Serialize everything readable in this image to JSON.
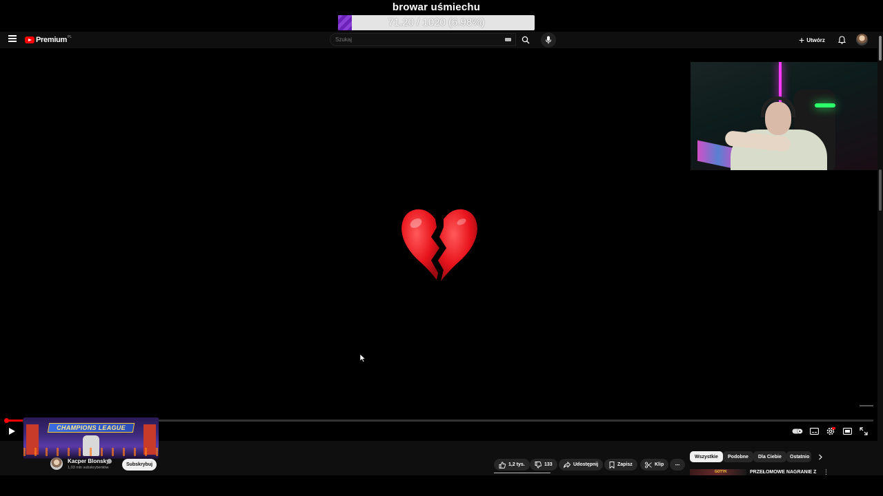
{
  "overlay": {
    "goal_title": "browar uśmiechu",
    "goal_text": "71.20 / 1020 (6.98%)",
    "goal_fraction": 0.0698,
    "goal_color": "#7a32c8"
  },
  "masthead": {
    "logo_text": "Premium",
    "logo_region": "PL",
    "search_placeholder": "Szukaj",
    "create_label": "Utwórz",
    "icons": [
      "menu-icon",
      "youtube-logo-icon",
      "keyboard-icon",
      "search-icon",
      "mic-icon",
      "plus-icon",
      "bell-icon",
      "avatar"
    ]
  },
  "player": {
    "center_emoji": "broken-heart",
    "progress_fraction": 0.02,
    "accent_color": "#ff0000",
    "controls": [
      "play-icon",
      "autoplay-toggle",
      "subtitles-icon",
      "settings-icon",
      "theater-icon",
      "fullscreen-icon"
    ]
  },
  "endscreen": {
    "banner_text": "CHAMPIONS LEAGUE"
  },
  "channel": {
    "name": "Kacper Blonsky",
    "subscribers": "1,03 mln subskrybentów",
    "subscribe_label": "Subskrybuj"
  },
  "actions": {
    "likes": "1,2 tys.",
    "dislikes": "133",
    "share": "Udostępnij",
    "save": "Zapisz",
    "clip": "Klip",
    "more": "⋯"
  },
  "chips": [
    "Wszystkie",
    "Podobne",
    "Dla Ciebie",
    "Ostatnio"
  ],
  "recommendation": {
    "thumb_text": "GOTYK",
    "title": "PRZEŁOMOWE NAGRANIE Z"
  }
}
